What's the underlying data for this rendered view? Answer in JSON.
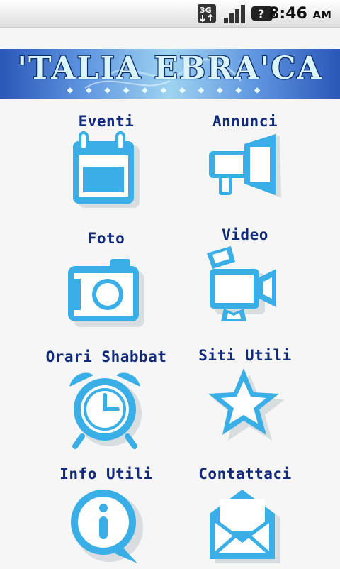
{
  "status_bar": {
    "network": "3G",
    "time": "8:46",
    "ampm": "AM",
    "icons": [
      "network-3g-icon",
      "signal-icon",
      "battery-unknown-icon"
    ]
  },
  "banner": {
    "title": "'TALIA EBRA'CA"
  },
  "menu": {
    "items": [
      {
        "label": "Eventi",
        "icon": "calendar-icon"
      },
      {
        "label": "Annunci",
        "icon": "megaphone-icon"
      },
      {
        "label": "Foto",
        "icon": "camera-icon"
      },
      {
        "label": "Video",
        "icon": "video-camera-icon"
      },
      {
        "label": "Orari Shabbat",
        "icon": "alarm-clock-icon"
      },
      {
        "label": "Siti Utili",
        "icon": "star-icon"
      },
      {
        "label": "Info Utili",
        "icon": "info-icon"
      },
      {
        "label": "Contattaci",
        "icon": "envelope-icon"
      }
    ]
  },
  "colors": {
    "icon_blue": "#3aaee6",
    "icon_shadow": "#cfd6db",
    "label_navy": "#112a7a"
  }
}
